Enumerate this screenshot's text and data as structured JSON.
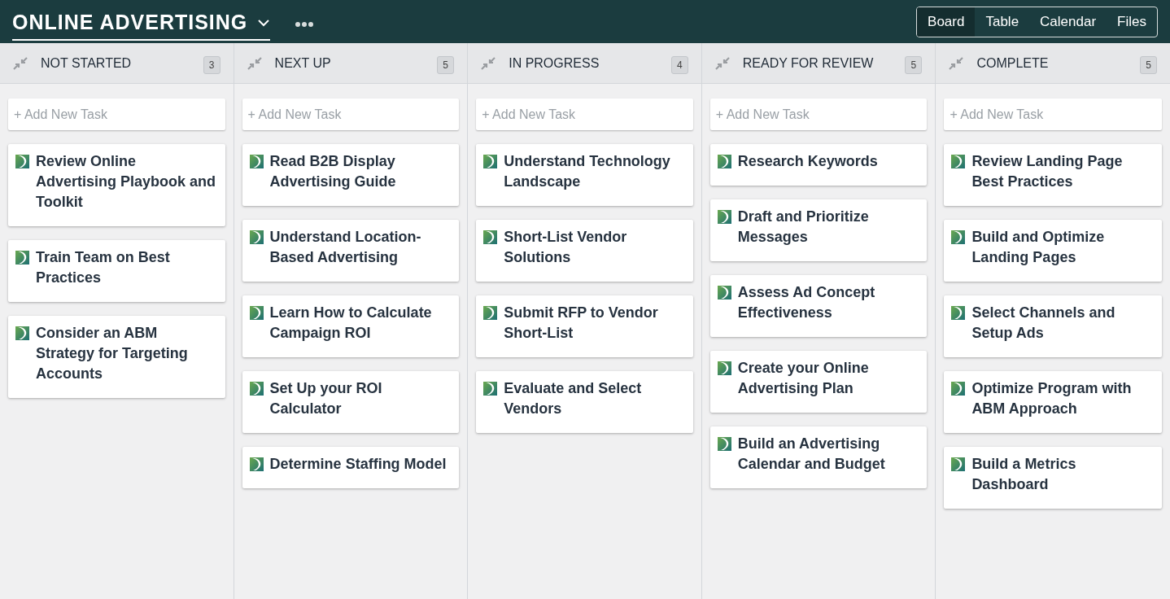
{
  "board_title": "ONLINE ADVERTISING",
  "views": [
    {
      "label": "Board",
      "selected": true
    },
    {
      "label": "Table",
      "selected": false
    },
    {
      "label": "Calendar",
      "selected": false
    },
    {
      "label": "Files",
      "selected": false
    }
  ],
  "columns": [
    {
      "name": "NOT STARTED",
      "count": "3",
      "add_placeholder": "+ Add New Task",
      "tasks": [
        "Review Online Advertising Playbook and Toolkit",
        "Train Team on Best Practices",
        "Consider an ABM Strategy for Targeting Accounts"
      ]
    },
    {
      "name": "NEXT UP",
      "count": "5",
      "add_placeholder": "+ Add New Task",
      "tasks": [
        "Read B2B Display Advertising Guide",
        "Understand Location-Based Advertising",
        "Learn How to Calculate Campaign ROI",
        "Set Up your ROI Calculator",
        "Determine Staffing Model"
      ]
    },
    {
      "name": "IN PROGRESS",
      "count": "4",
      "add_placeholder": "+ Add New Task",
      "tasks": [
        "Understand Technology Landscape",
        "Short-List Vendor Solutions",
        "Submit RFP to Vendor Short-List",
        "Evaluate and Select Vendors"
      ]
    },
    {
      "name": "READY FOR REVIEW",
      "count": "5",
      "add_placeholder": "+ Add New Task",
      "tasks": [
        "Research Keywords",
        "Draft and Prioritize Messages",
        "Assess Ad Concept Effectiveness",
        "Create your Online Advertising Plan",
        "Build an Advertising Calendar and Budget"
      ]
    },
    {
      "name": "COMPLETE",
      "count": "5",
      "add_placeholder": "+ Add New Task",
      "tasks": [
        "Review Landing Page Best Practices",
        "Build and Optimize Landing Pages",
        "Select Channels and Setup Ads",
        "Optimize Program with ABM Approach",
        "Build a Metrics Dashboard"
      ]
    }
  ]
}
